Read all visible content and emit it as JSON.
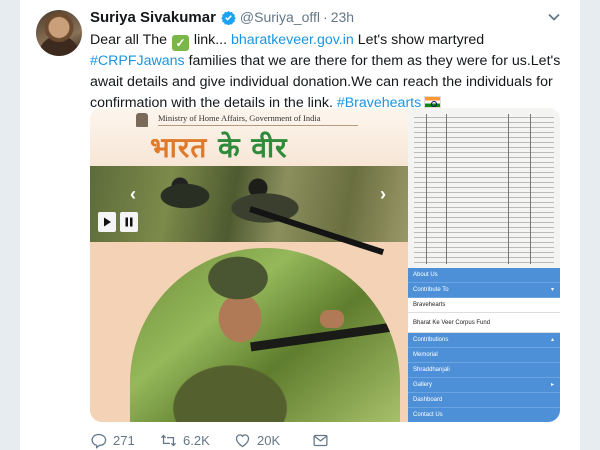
{
  "tweet": {
    "author_name": "Suriya Sivakumar",
    "handle": "@Suriya_offl",
    "separator": "·",
    "time": "23h",
    "text": {
      "part1": "Dear all The ",
      "check_emoji": "✓",
      "part2": " link... ",
      "link": "bharatkeveer.gov.in",
      "part3": "  Let's show martyred ",
      "hashtag1": "#CRPFJawans",
      "part4": " families that we are there for them as they were for us.Let's await details and give individual donation.We can reach the individuals for confirmation with the details in the link. ",
      "hashtag2": "#Bravehearts"
    }
  },
  "media": {
    "ministry_label": "Ministry of Home Affairs, Government of India",
    "hindi_title_orange": "भारत",
    "hindi_title_green": "के वीर",
    "nav_left": "‹",
    "nav_right": "›",
    "menu_items": [
      {
        "label": "About Us",
        "style": "blue"
      },
      {
        "label": "Contribute To",
        "style": "blue",
        "caret": "▾"
      },
      {
        "label": "Bravehearts",
        "style": "white"
      },
      {
        "label": "Bharat Ke Veer Corpus Fund",
        "style": "white"
      },
      {
        "label": "Contributions",
        "style": "blue",
        "caret": "▴"
      },
      {
        "label": "Memorial",
        "style": "blue"
      },
      {
        "label": "Shraddhanjali",
        "style": "blue"
      },
      {
        "label": "Gallery",
        "style": "blue",
        "caret": "▸"
      },
      {
        "label": "Dashboard",
        "style": "blue"
      },
      {
        "label": "Contact Us",
        "style": "blue"
      }
    ]
  },
  "actions": {
    "replies": "271",
    "retweets": "6.2K",
    "likes": "20K"
  },
  "colors": {
    "link": "#1b95e0",
    "muted": "#657786",
    "menu_blue": "#4d90d8",
    "saffron": "#e07a2a",
    "green": "#2e8b3a"
  }
}
